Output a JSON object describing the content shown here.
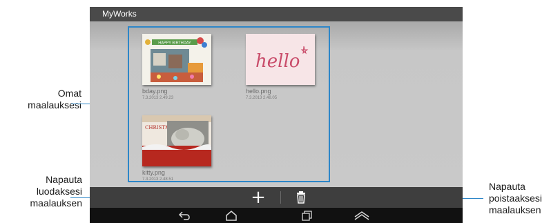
{
  "callouts": {
    "my_paintings": [
      "Omat",
      "maalauksesi"
    ],
    "create": [
      "Napauta",
      "luodaksesi",
      "maalauksen"
    ],
    "delete": [
      "Napauta",
      "poistaaksesi",
      "maalauksen"
    ]
  },
  "app": {
    "title": "MyWorks"
  },
  "gallery": {
    "items": [
      {
        "name": "bday.png",
        "date": "7.3.2013 2.49.23"
      },
      {
        "name": "hello.png",
        "date": "7.3.2013 2.48.05"
      },
      {
        "name": "kitty.png",
        "date": "7.3.2013 2.48.51"
      }
    ],
    "hello_text": "hello",
    "bday_banner": "HAPPY BIRTHDAY",
    "kitty_banner": "CHRISTMAS"
  },
  "actions": {
    "add_label": "+",
    "add_icon": "plus-icon",
    "delete_icon": "trash-icon"
  },
  "nav": {
    "icons": [
      "back-icon",
      "home-icon",
      "recent-apps-icon",
      "menu-up-icon"
    ]
  },
  "colors": {
    "accent": "#2d86c8",
    "titlebar": "#4a4a4a",
    "actionbar": "#3e3e3e",
    "navbar": "#111111"
  }
}
